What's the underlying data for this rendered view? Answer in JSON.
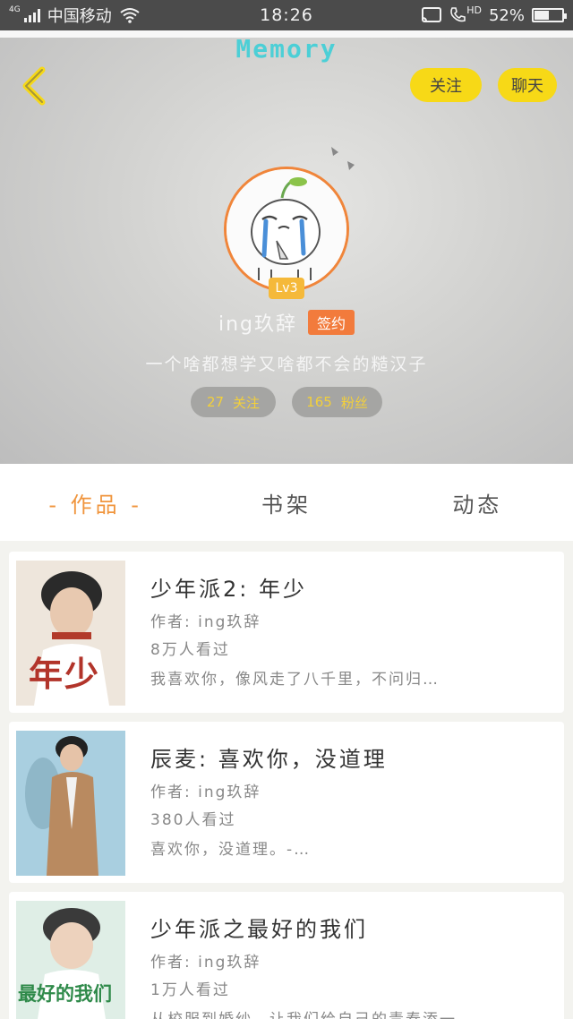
{
  "status_bar": {
    "network_label": "4G",
    "carrier": "中国移动",
    "time": "18:26",
    "battery": "52%",
    "battery_level": 0.52,
    "hd_label": "HD"
  },
  "header": {
    "app_title": "Memory",
    "follow_label": "关注",
    "chat_label": "聊天",
    "level": "Lv3",
    "username": "ing玖辞",
    "signed_label": "签约",
    "bio": "一个啥都想学又啥都不会的糙汉子",
    "stats": {
      "following_count": "27",
      "following_label": "关注",
      "fans_count": "165",
      "fans_label": "粉丝"
    },
    "colors": {
      "accent": "#f7d917",
      "title": "#4ccfd6",
      "badge": "#f27b3c"
    }
  },
  "tabs": [
    {
      "label": "- 作品 -",
      "active": true
    },
    {
      "label": "书架",
      "active": false
    },
    {
      "label": "动态",
      "active": false
    }
  ],
  "books": [
    {
      "title": "少年派2: 年少",
      "author": "作者: ing玖辞",
      "reads": "8万人看过",
      "desc": "我喜欢你，像风走了八千里，不问归…",
      "cover_text": "年少"
    },
    {
      "title": "辰麦: 喜欢你，没道理",
      "author": "作者: ing玖辞",
      "reads": "380人看过",
      "desc": "喜欢你，没道理。-…",
      "cover_text": ""
    },
    {
      "title": "少年派之最好的我们",
      "author": "作者: ing玖辞",
      "reads": "1万人看过",
      "desc": "从校服到婚纱，让我们给自己的青春添一…",
      "cover_text": "最好的我们"
    }
  ]
}
